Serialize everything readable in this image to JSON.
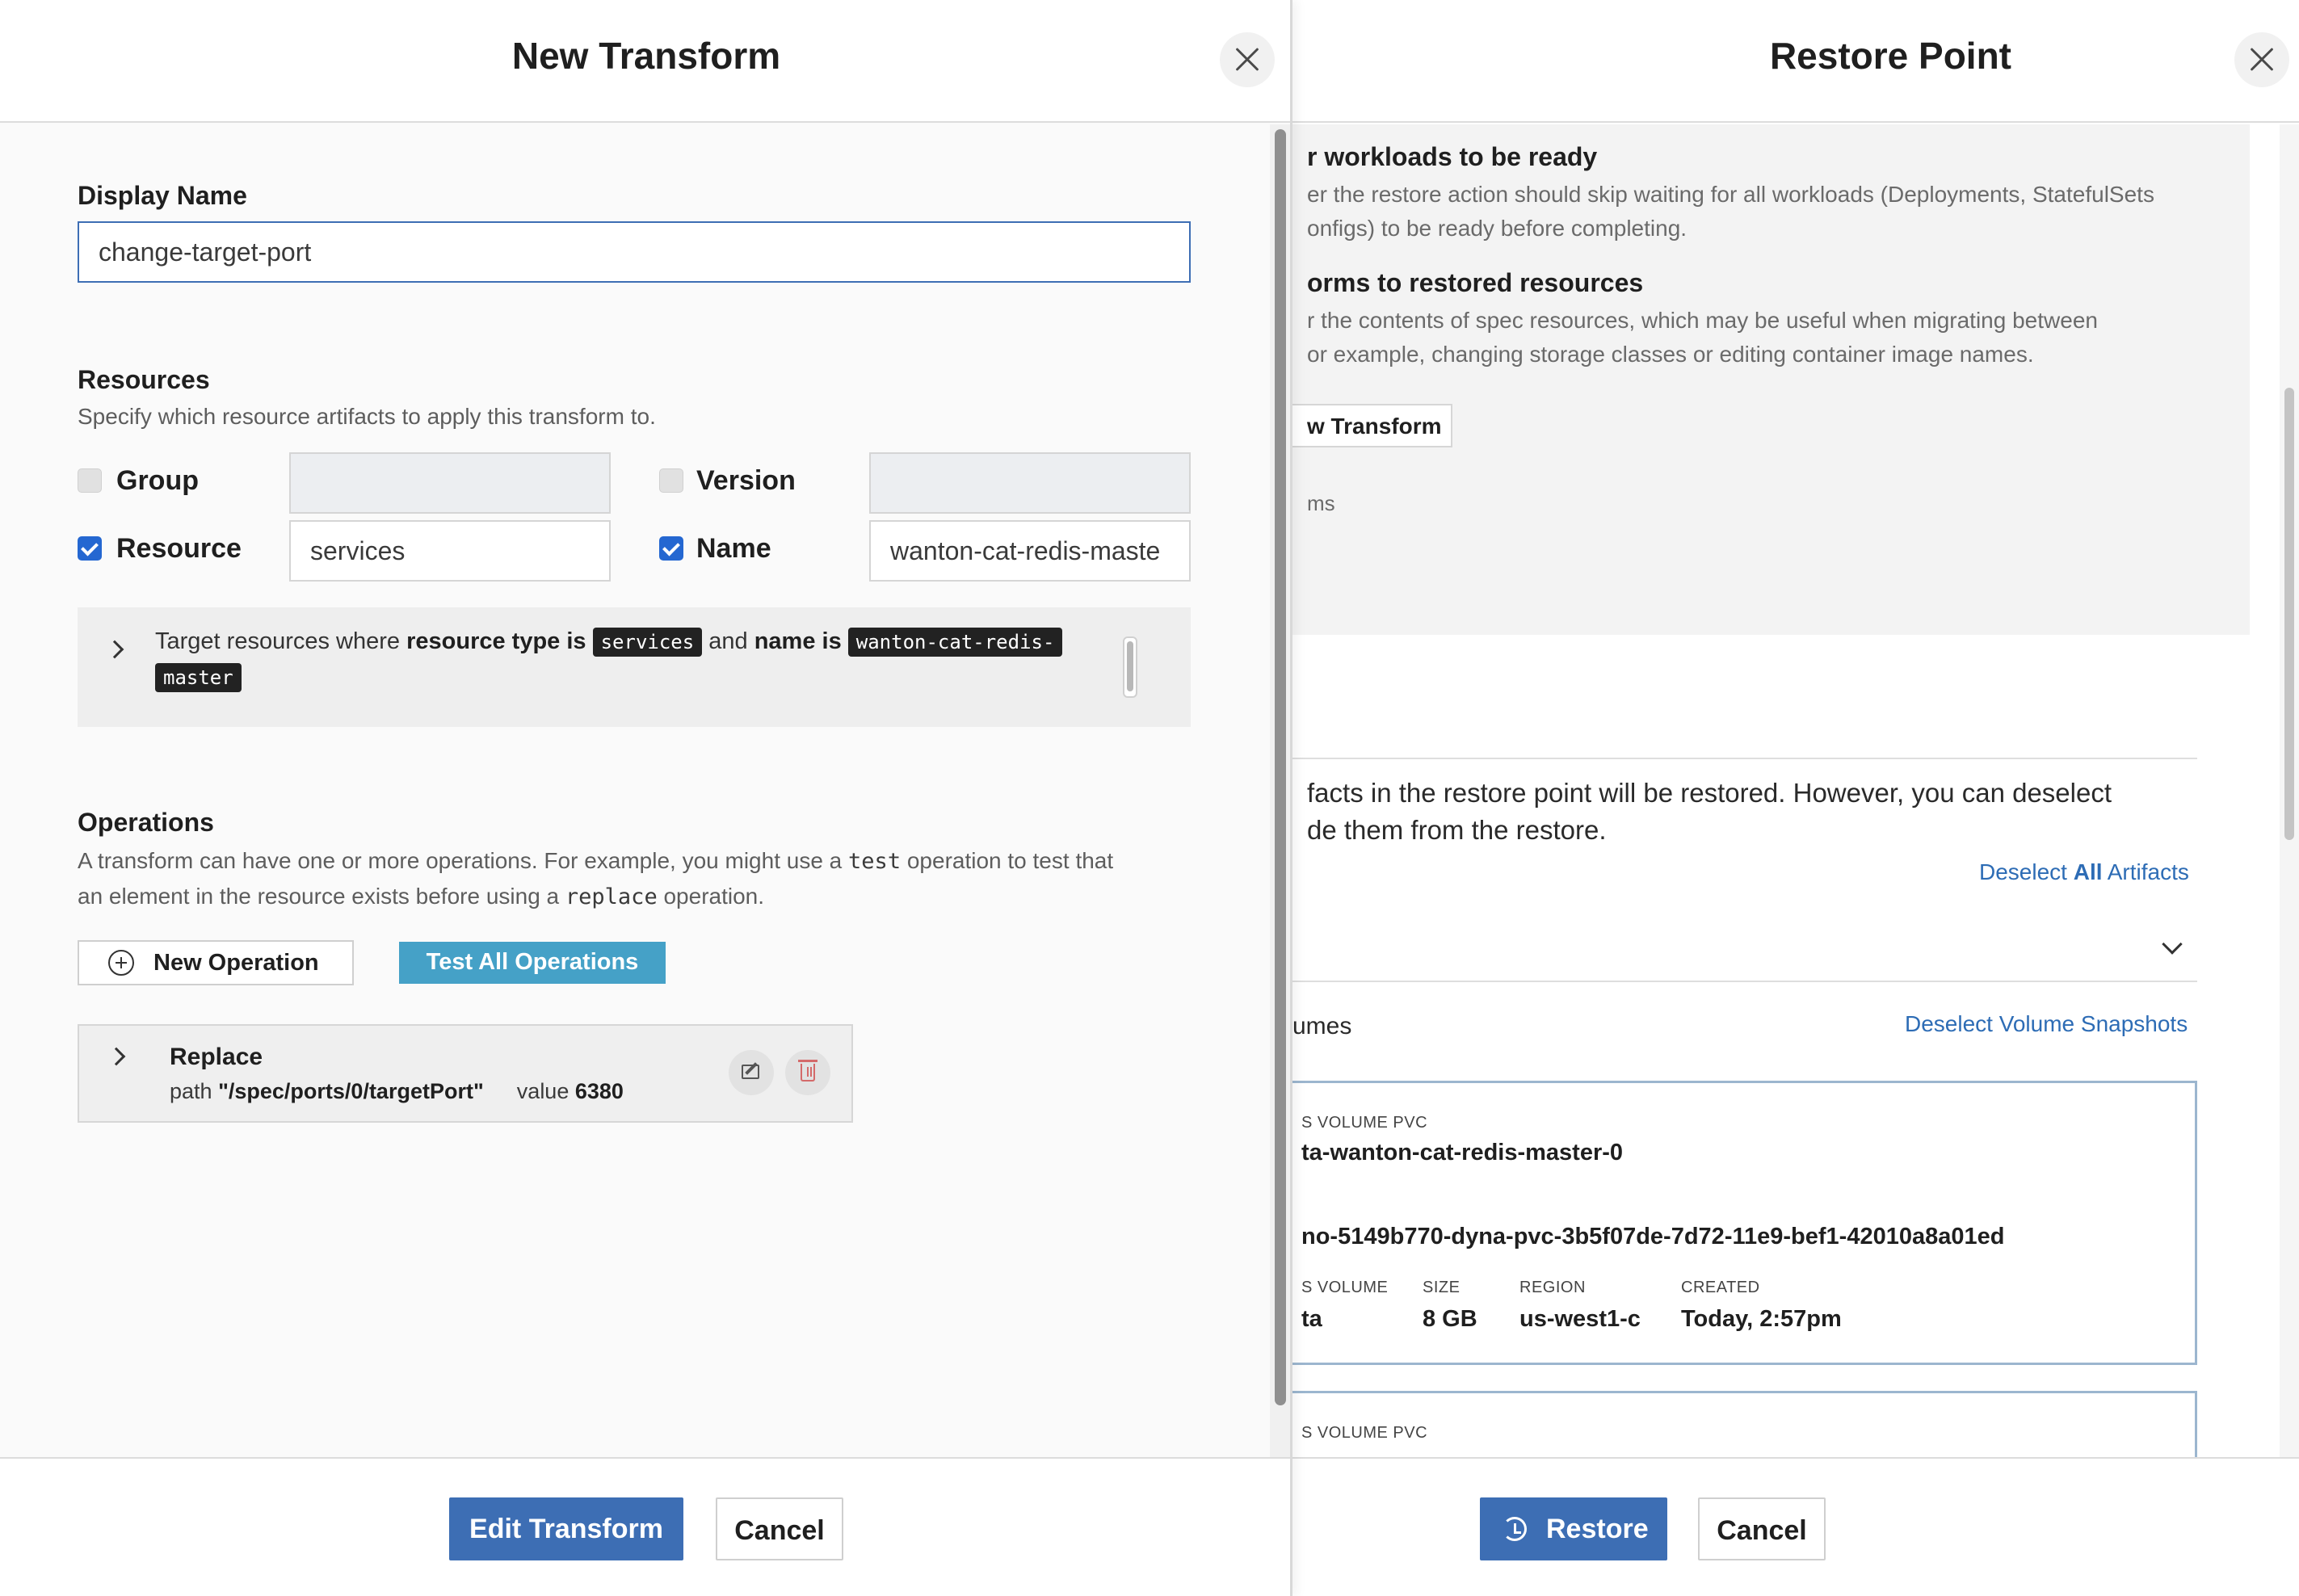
{
  "restore_point": {
    "title": "Restore Point",
    "wait_heading": "r workloads to be ready",
    "wait_desc_1": "er the restore action should skip waiting for all workloads (Deployments, StatefulSets",
    "wait_desc_2": "onfigs) to be ready before completing.",
    "transforms_heading": "orms to restored resources",
    "transforms_desc_1": "r the contents of spec resources, which may be useful when migrating between",
    "transforms_desc_2": "or example, changing storage classes or editing container image names.",
    "new_transform_button": "w Transform",
    "transforms_count": "ms",
    "artifacts_desc_1": "facts in the restore point will be restored. However, you can deselect",
    "artifacts_desc_2": "de them from the restore.",
    "deselect_prefix": "Deselect",
    "deselect_all": "All",
    "deselect_suffix": "Artifacts",
    "volumes_label": "umes",
    "deselect_volume_snapshots": "Deselect Volume Snapshots",
    "volumes": [
      {
        "type_label": "S VOLUME PVC",
        "pvc_name": "ta-wanton-cat-redis-master-0",
        "volume_id": "no-5149b770-dyna-pvc-3b5f07de-7d72-11e9-bef1-42010a8a01ed",
        "col_volume_label": "S VOLUME",
        "col_volume_value": "ta",
        "col_size_label": "SIZE",
        "col_size_value": "8 GB",
        "col_region_label": "REGION",
        "col_region_value": "us-west1-c",
        "col_created_label": "CREATED",
        "col_created_value": "Today, 2:57pm"
      },
      {
        "type_label": "S VOLUME PVC"
      }
    ],
    "restore_button": "Restore",
    "cancel_button": "Cancel"
  },
  "new_transform": {
    "title": "New Transform",
    "display_name_label": "Display Name",
    "display_name_value": "change-target-port",
    "resources_label": "Resources",
    "resources_desc": "Specify which resource artifacts to apply this transform to.",
    "group_label": "Group",
    "group_value": "",
    "version_label": "Version",
    "version_value": "",
    "resource_label": "Resource",
    "resource_value": "services",
    "name_label": "Name",
    "name_value": "wanton-cat-redis-maste",
    "target": {
      "prefix": "Target resources where",
      "resource_type_is": "resource type is",
      "resource_tag": "services",
      "and": "and",
      "name_is": "name is",
      "name_tag_1": "wanton-cat-redis-",
      "name_tag_2": "master"
    },
    "operations_label": "Operations",
    "operations_desc_1a": "A transform can have one or more operations. For example, you might use a",
    "operations_desc_1code": "test",
    "operations_desc_1b": "operation to test that",
    "operations_desc_2a": "an element in the resource exists before using a",
    "operations_desc_2code": "replace",
    "operations_desc_2b": "operation.",
    "new_operation_button": "New Operation",
    "test_all_button": "Test All Operations",
    "operation": {
      "name": "Replace",
      "path_label": "path",
      "path_value": "\"/spec/ports/0/targetPort\"",
      "value_label": "value",
      "value_value": "6380"
    },
    "edit_button": "Edit Transform",
    "cancel_button": "Cancel"
  }
}
